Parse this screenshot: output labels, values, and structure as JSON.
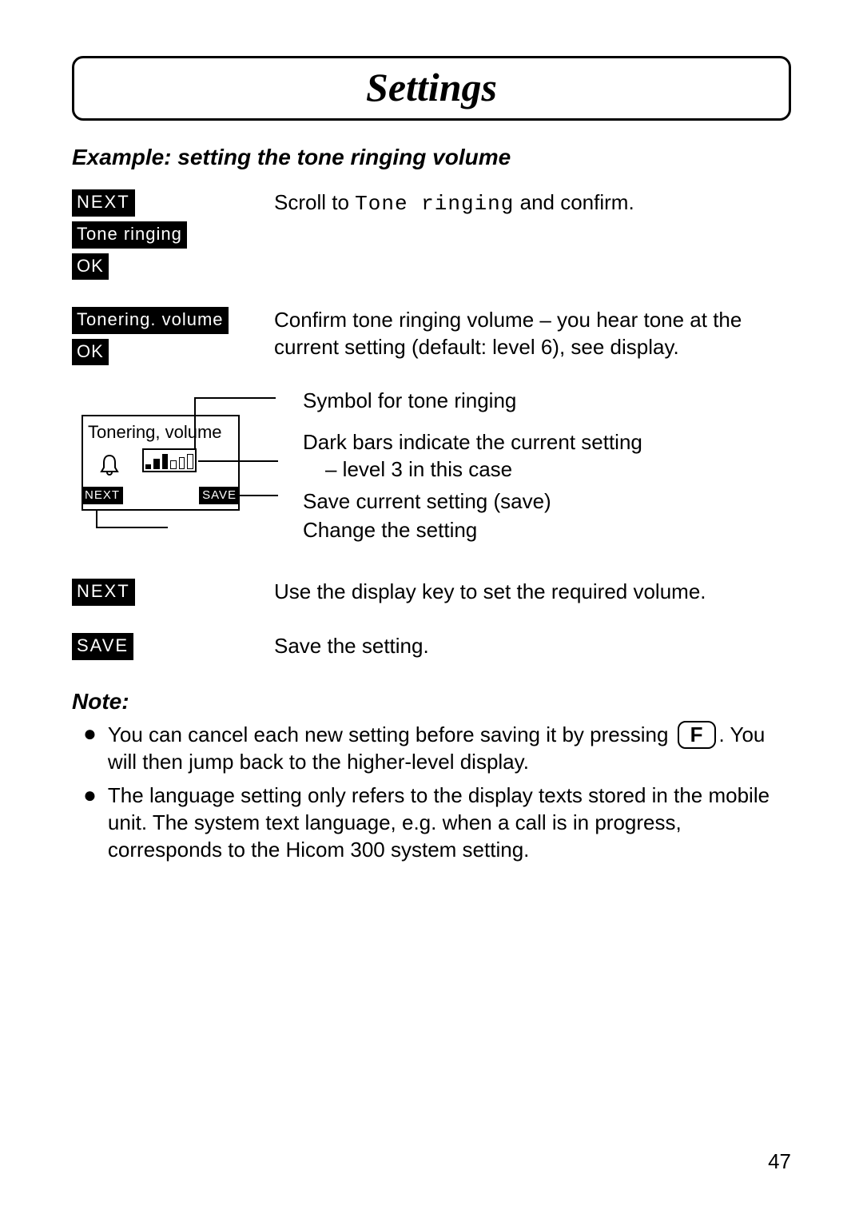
{
  "title": "Settings",
  "subhead": "Example: setting the tone ringing volume",
  "step1": {
    "next": "NEXT",
    "menu": "Tone ringing",
    "ok": "OK",
    "lcd_text": "Tone ringing",
    "desc_before": "Scroll to ",
    "desc_after": " and confirm."
  },
  "step2": {
    "menu": "Tonering. volume",
    "ok": "OK",
    "desc": "Confirm tone ringing volume – you hear tone at the current setting (default: level 6), see display."
  },
  "diagram": {
    "title": "Tonering, volume",
    "btn_left": "NEXT",
    "btn_right": "SAVE",
    "line1": "Symbol for tone ringing",
    "line2a": "Dark bars indicate the current setting",
    "line2b": "– level 3 in this case",
    "line3": "Save current setting (save)",
    "line4": "Change the setting"
  },
  "step3": {
    "next": "NEXT",
    "desc": "Use the display key to set the required volume."
  },
  "step4": {
    "save": "SAVE",
    "desc": "Save the setting."
  },
  "note_head": "Note:",
  "note1a": "You can cancel each new setting before saving it by pressing ",
  "note1_key": "F",
  "note1b": ". You will then jump back to the higher-level display.",
  "note2": "The language setting only refers to the display texts stored in the mobile unit. The system text language, e.g. when a call is in progress, corresponds to the Hicom 300 system setting.",
  "page_num": "47"
}
